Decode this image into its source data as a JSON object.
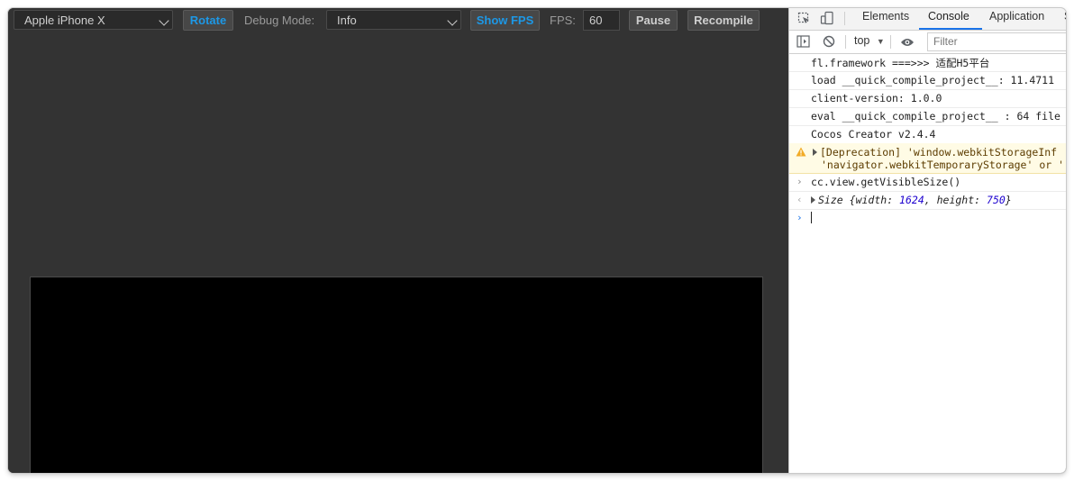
{
  "toolbar": {
    "device_select": "Apple iPhone X",
    "rotate_label": "Rotate",
    "debug_mode_label": "Debug Mode:",
    "debug_mode_value": "Info",
    "show_fps_label": "Show FPS",
    "fps_label": "FPS:",
    "fps_value": "60",
    "pause_label": "Pause",
    "recompile_label": "Recompile"
  },
  "devtools": {
    "tabs": [
      {
        "label": "Elements"
      },
      {
        "label": "Console"
      },
      {
        "label": "Application"
      },
      {
        "label": "S"
      }
    ],
    "active_tab": "Console",
    "context_select": "top",
    "filter_placeholder": "Filter"
  },
  "console": {
    "lines": [
      "fl.framework ===>>> 适配H5平台",
      "load __quick_compile_project__: 11.4711",
      "client-version: 1.0.0",
      "eval __quick_compile_project__ : 64 file",
      "Cocos Creator v2.4.4"
    ],
    "warning_line1": "[Deprecation] 'window.webkitStorageInf",
    "warning_line2": "'navigator.webkitTemporaryStorage' or '",
    "command": "cc.view.getVisibleSize()",
    "result": {
      "type": "Size",
      "width_key": "width",
      "width_value": "1624",
      "height_key": "height",
      "height_value": "750"
    }
  },
  "colors": {
    "accent": "#1d98e6",
    "panel_bg": "#333333",
    "canvas_bg": "#000000"
  }
}
